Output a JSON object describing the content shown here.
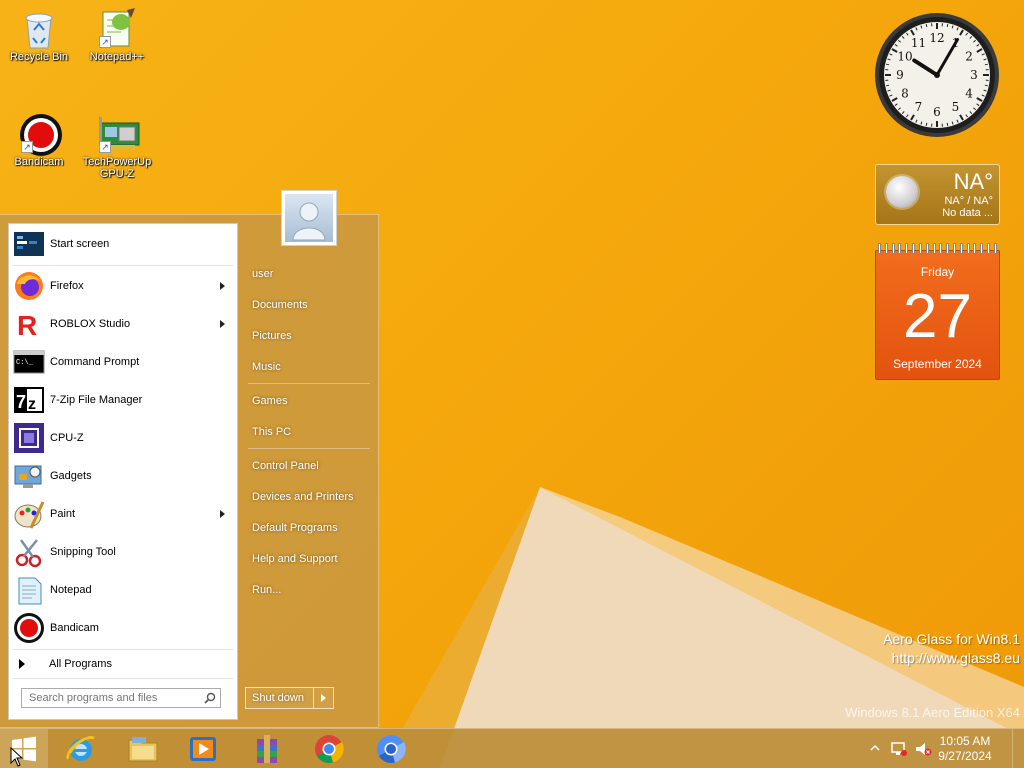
{
  "desktop": {
    "icons": [
      {
        "label": "Recycle Bin",
        "icon": "recycle-bin-icon"
      },
      {
        "label": "Notepad++",
        "icon": "notepad-plus-plus-icon"
      },
      {
        "label": "Bandicam",
        "icon": "bandicam-icon"
      },
      {
        "label": "TechPowerUp GPU-Z",
        "icon": "gpuz-icon"
      }
    ]
  },
  "start_menu": {
    "programs": [
      {
        "label": "Start screen",
        "icon": "start-screen-icon",
        "submenu": false
      },
      {
        "label": "Firefox",
        "icon": "firefox-icon",
        "submenu": true
      },
      {
        "label": "ROBLOX Studio",
        "icon": "roblox-studio-icon",
        "submenu": true
      },
      {
        "label": "Command Prompt",
        "icon": "command-prompt-icon",
        "submenu": false
      },
      {
        "label": "7-Zip File Manager",
        "icon": "seven-zip-icon",
        "submenu": false
      },
      {
        "label": "CPU-Z",
        "icon": "cpuz-icon",
        "submenu": false
      },
      {
        "label": "Gadgets",
        "icon": "gadgets-icon",
        "submenu": false
      },
      {
        "label": "Paint",
        "icon": "paint-icon",
        "submenu": true
      },
      {
        "label": "Snipping Tool",
        "icon": "snipping-tool-icon",
        "submenu": false
      },
      {
        "label": "Notepad",
        "icon": "notepad-icon",
        "submenu": false
      },
      {
        "label": "Bandicam",
        "icon": "bandicam-icon",
        "submenu": false
      }
    ],
    "all_programs": "All Programs",
    "search_placeholder": "Search programs and files",
    "right_items": [
      {
        "label": "user"
      },
      {
        "label": "Documents"
      },
      {
        "label": "Pictures"
      },
      {
        "label": "Music"
      },
      {
        "label": "Games"
      },
      {
        "label": "This PC"
      },
      {
        "label": "Control Panel"
      },
      {
        "label": "Devices and Printers"
      },
      {
        "label": "Default Programs"
      },
      {
        "label": "Help and Support"
      },
      {
        "label": "Run..."
      }
    ],
    "shutdown_label": "Shut down"
  },
  "gadgets": {
    "clock": {
      "hour": 10,
      "minute": 5,
      "numerals": [
        "12",
        "1",
        "2",
        "3",
        "4",
        "5",
        "6",
        "7",
        "8",
        "9",
        "10",
        "11"
      ]
    },
    "weather": {
      "temp": "NA°",
      "range": "NA° / NA°",
      "status": "No data ..."
    },
    "calendar": {
      "weekday": "Friday",
      "day": "27",
      "month_year": "September 2024"
    }
  },
  "watermark": {
    "line1": "Aero Glass for Win8.1",
    "line2": "http://www.glass8.eu",
    "edition": "Windows 8.1 Aero Edition X64"
  },
  "taskbar": {
    "apps": [
      {
        "icon": "internet-explorer-icon"
      },
      {
        "icon": "file-explorer-icon"
      },
      {
        "icon": "media-player-icon"
      },
      {
        "icon": "winrar-icon"
      },
      {
        "icon": "chrome-icon"
      },
      {
        "icon": "chromium-icon"
      }
    ],
    "time": "10:05 AM",
    "date": "9/27/2024"
  },
  "colors": {
    "wallpaper": "#f5a80c",
    "start_menu_glass": "#c49646",
    "calendar_orange": "#e3530f"
  }
}
